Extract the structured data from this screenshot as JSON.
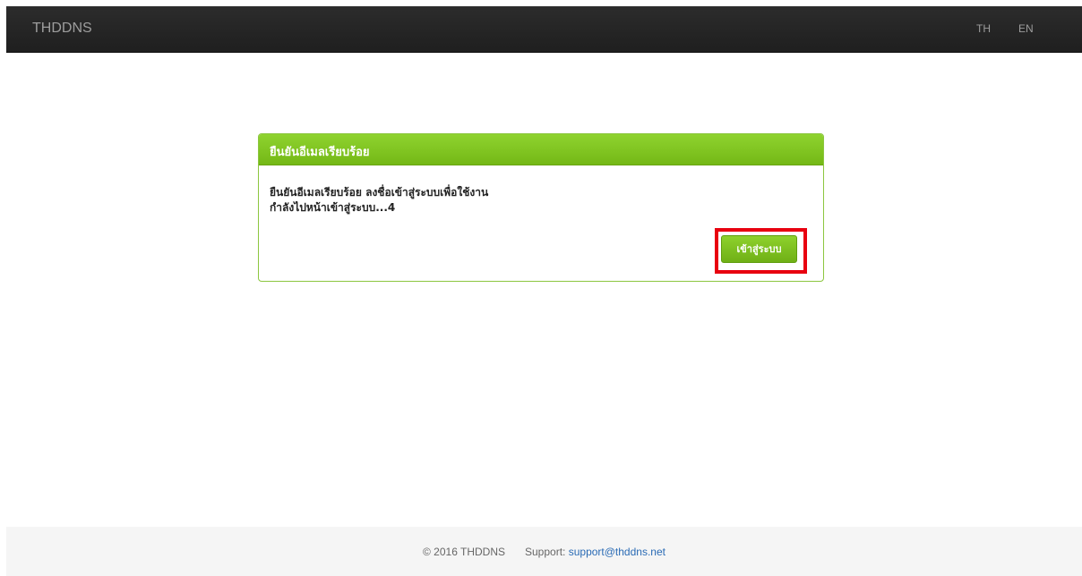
{
  "navbar": {
    "brand": "THDDNS",
    "languages": [
      "TH",
      "EN"
    ]
  },
  "panel": {
    "title": "ยืนยันอีเมลเรียบร้อย",
    "message_line1": "ยืนยันอีเมลเรียบร้อย ลงชื่อเข้าสู่ระบบเพื่อใช้งาน",
    "message_line2": "กำลังไปหน้าเข้าสู่ระบบ...4",
    "login_button_label": "เข้าสู่ระบบ"
  },
  "colors": {
    "navbar_bg": "#222222",
    "panel_accent": "#7cbd1e",
    "highlight_border": "#e8000f",
    "link": "#2a6bb5"
  },
  "footer": {
    "copyright": "© 2016 THDDNS",
    "support_label": "Support:",
    "support_email": "support@thddns.net"
  }
}
